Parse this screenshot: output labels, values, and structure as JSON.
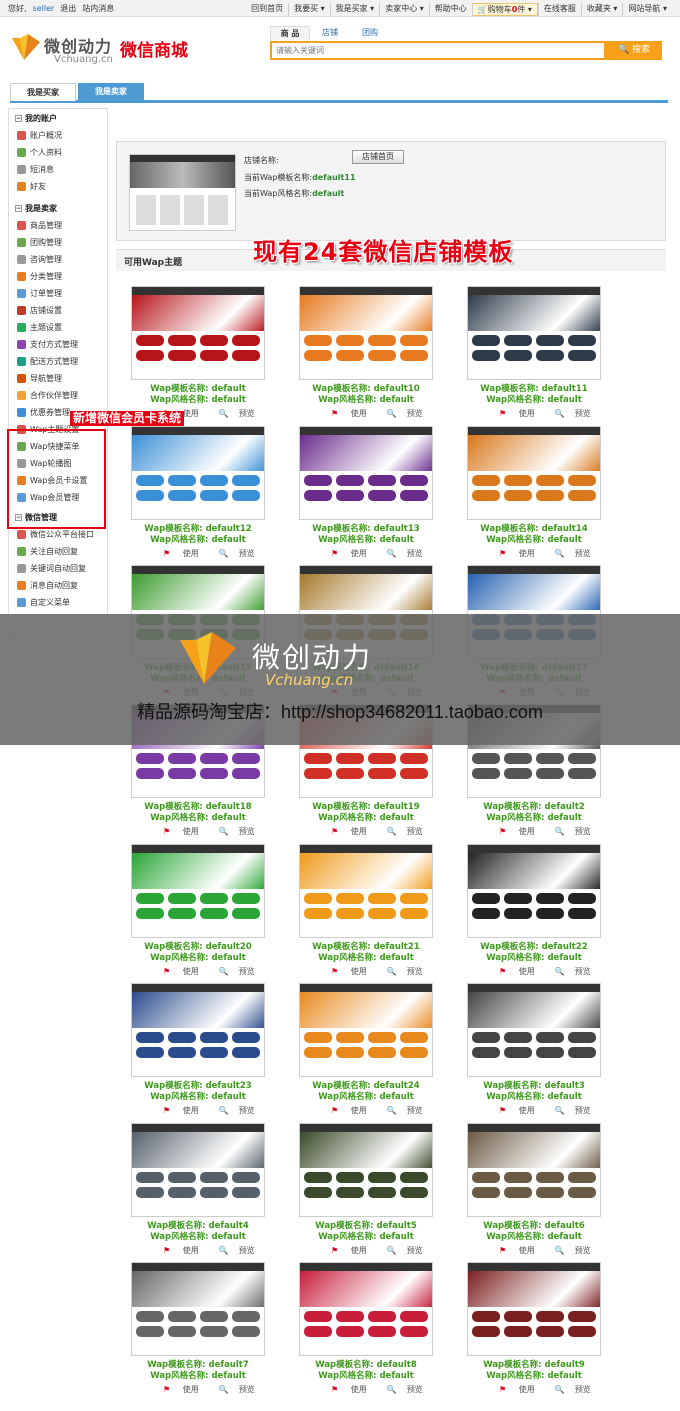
{
  "topbar": {
    "greeting": "您好,",
    "user": "seller",
    "logout": "退出",
    "messages": "站内消息",
    "links": [
      "回到首页",
      "我要买 ▾",
      "我是买家 ▾",
      "卖家中心 ▾",
      "帮助中心"
    ],
    "cart_prefix": "购物车",
    "cart_count": "0",
    "cart_suffix": "件 ▾",
    "links2": [
      "在线客服",
      "收藏夹 ▾",
      "网站导航 ▾"
    ]
  },
  "logo": {
    "cn": "微创动力",
    "en": "Vchuang.cn",
    "shop": "微信商城"
  },
  "search": {
    "tabs": [
      "商 品",
      "店铺",
      "团购"
    ],
    "placeholder": "请输入关键词",
    "button": "🔍 搜索"
  },
  "roles": {
    "buyer": "我是买家",
    "seller": "我是卖家"
  },
  "sidebar": {
    "section1": "我的账户",
    "items1": [
      "账户概况",
      "个人资料",
      "短消息",
      "好友"
    ],
    "section2": "我是卖家",
    "items2": [
      "商品管理",
      "团购管理",
      "咨询管理",
      "分类管理",
      "订单管理",
      "店铺设置",
      "主题设置",
      "支付方式管理",
      "配送方式管理",
      "导航管理",
      "合作伙伴管理",
      "优惠券管理"
    ],
    "items3": [
      "Wap主题设置",
      "Wap快捷菜单",
      "Wap轮播图",
      "Wap会员卡设置",
      "Wap会员管理"
    ],
    "section3": "微信管理",
    "items4": [
      "微信公众平台接口",
      "关注自动回复",
      "关键词自动回复",
      "消息自动回复",
      "自定义菜单"
    ]
  },
  "new_label": "新增微信会员卡系统",
  "shop": {
    "name_label": "店铺名称:",
    "button": "店铺首页",
    "template_label": "当前Wap模板名称:",
    "template": "default11",
    "style_label": "当前Wap风格名称:",
    "style": "default"
  },
  "theme_header": "可用Wap主题",
  "headline": "现有24套微信店铺模板",
  "card_labels": {
    "template": "Wap模板名称: ",
    "style": "Wap风格名称: ",
    "use": "使用",
    "preview": "预览"
  },
  "templates": [
    {
      "name": "default",
      "style": "default",
      "color": "#b8151b"
    },
    {
      "name": "default10",
      "style": "default",
      "color": "#e77a1f"
    },
    {
      "name": "default11",
      "style": "default",
      "color": "#2d3a4a"
    },
    {
      "name": "default12",
      "style": "default",
      "color": "#3b8fd6"
    },
    {
      "name": "default13",
      "style": "default",
      "color": "#6a2b8c"
    },
    {
      "name": "default14",
      "style": "default",
      "color": "#d9781c"
    },
    {
      "name": "default15",
      "style": "default",
      "color": "#3c9a2e"
    },
    {
      "name": "default16",
      "style": "default",
      "color": "#a6782c"
    },
    {
      "name": "default17",
      "style": "default",
      "color": "#2461b0"
    },
    {
      "name": "default18",
      "style": "default",
      "color": "#7a3aa6"
    },
    {
      "name": "default19",
      "style": "default",
      "color": "#d03026"
    },
    {
      "name": "default2",
      "style": "default",
      "color": "#555555"
    },
    {
      "name": "default20",
      "style": "default",
      "color": "#2aa536"
    },
    {
      "name": "default21",
      "style": "default",
      "color": "#f09a1a"
    },
    {
      "name": "default22",
      "style": "default",
      "color": "#222222"
    },
    {
      "name": "default23",
      "style": "default",
      "color": "#2b4c8c"
    },
    {
      "name": "default24",
      "style": "default",
      "color": "#e8891e"
    },
    {
      "name": "default3",
      "style": "default",
      "color": "#444444"
    },
    {
      "name": "default4",
      "style": "default",
      "color": "#56606a"
    },
    {
      "name": "default5",
      "style": "default",
      "color": "#3a4a2a"
    },
    {
      "name": "default6",
      "style": "default",
      "color": "#6b5a44"
    },
    {
      "name": "default7",
      "style": "default",
      "color": "#666666"
    },
    {
      "name": "default8",
      "style": "default",
      "color": "#c81e3c"
    },
    {
      "name": "default9",
      "style": "default",
      "color": "#7b1f1f"
    }
  ],
  "watermark": {
    "cn": "微创动力",
    "en": "Vchuang.cn",
    "text": "精品源码淘宝店：http://shop34682011.taobao.com"
  }
}
